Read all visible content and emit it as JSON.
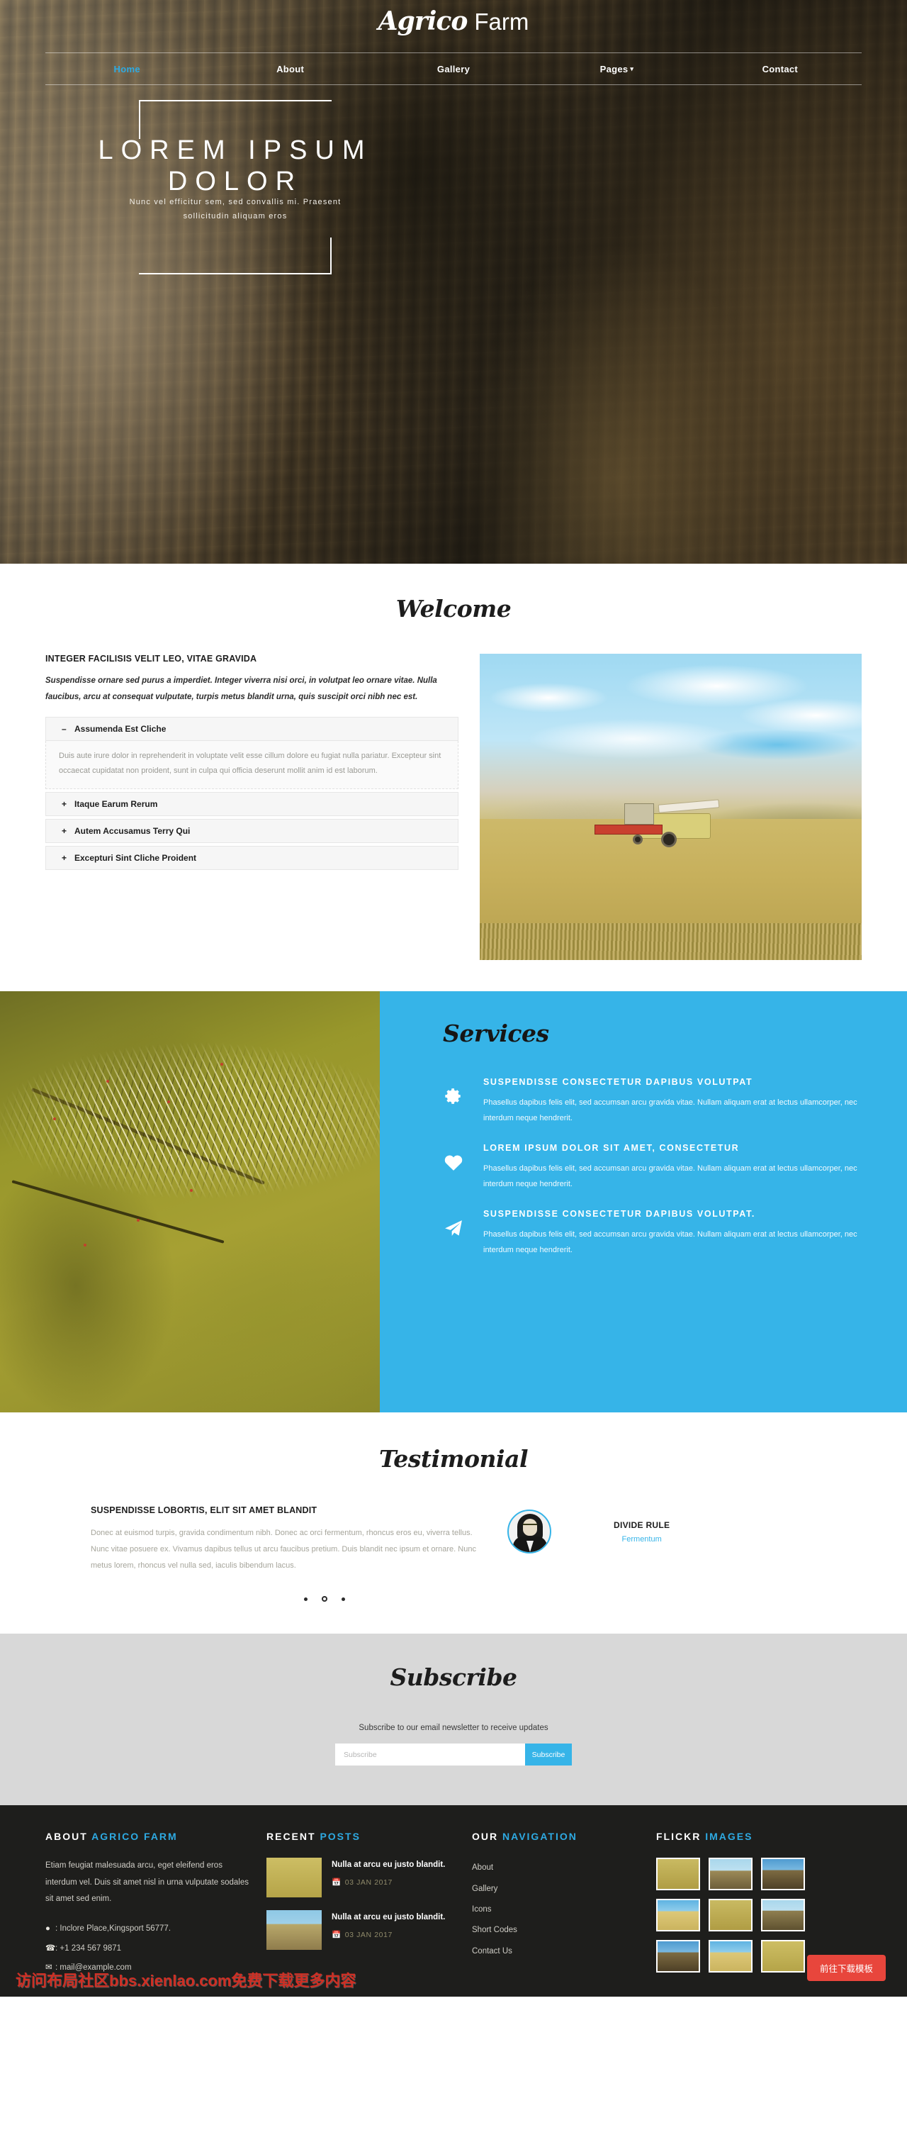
{
  "brand": {
    "word1": "Agrico",
    "word2": "Farm"
  },
  "nav": {
    "items": [
      {
        "label": "Home",
        "active": true
      },
      {
        "label": "About",
        "active": false
      },
      {
        "label": "Gallery",
        "active": false
      },
      {
        "label": "Pages",
        "active": false,
        "caret": "▾"
      },
      {
        "label": "Contact",
        "active": false
      }
    ]
  },
  "hero": {
    "title_line1": "LOREM  IPSUM",
    "title_line2": "DOLOR",
    "subtitle_line1": "Nunc vel efficitur sem, sed convallis mi. Praesent",
    "subtitle_line2": "sollicitudin aliquam eros"
  },
  "welcome": {
    "title": "Welcome",
    "heading": "INTEGER FACILISIS VELIT LEO, VITAE GRAVIDA",
    "lead": "Suspendisse ornare sed purus a imperdiet. Integer viverra nisi orci, in volutpat leo ornare vitae. Nulla faucibus, arcu at consequat vulputate, turpis metus blandit urna, quis suscipit orci nibh nec est.",
    "accordion": [
      {
        "sign": "–",
        "label": "Assumenda Est Cliche",
        "open": true,
        "body": "Duis aute irure dolor in reprehenderit in voluptate velit esse cillum dolore eu fugiat nulla pariatur. Excepteur sint occaecat cupidatat non proident, sunt in culpa qui officia deserunt mollit anim id est laborum."
      },
      {
        "sign": "+",
        "label": "Itaque Earum Rerum",
        "open": false,
        "body": ""
      },
      {
        "sign": "+",
        "label": "Autem Accusamus Terry Qui",
        "open": false,
        "body": ""
      },
      {
        "sign": "+",
        "label": "Excepturi Sint Cliche Proident",
        "open": false,
        "body": ""
      }
    ]
  },
  "services": {
    "title": "Services",
    "bg_color": "#36b4e8",
    "items": [
      {
        "icon": "gear-icon",
        "heading": "SUSPENDISSE CONSECTETUR DAPIBUS VOLUTPAT",
        "text": "Phasellus dapibus felis elit, sed accumsan arcu gravida vitae. Nullam aliquam erat at lectus ullamcorper, nec interdum neque hendrerit."
      },
      {
        "icon": "heart-icon",
        "heading": "LOREM IPSUM DOLOR SIT AMET, CONSECTETUR",
        "text": "Phasellus dapibus felis elit, sed accumsan arcu gravida vitae. Nullam aliquam erat at lectus ullamcorper, nec interdum neque hendrerit."
      },
      {
        "icon": "paper-plane-icon",
        "heading": "SUSPENDISSE CONSECTETUR DAPIBUS VOLUTPAT.",
        "text": "Phasellus dapibus felis elit, sed accumsan arcu gravida vitae. Nullam aliquam erat at lectus ullamcorper, nec interdum neque hendrerit."
      }
    ]
  },
  "testimonial": {
    "title": "Testimonial",
    "heading": "SUSPENDISSE LOBORTIS, ELIT SIT AMET BLANDIT",
    "text": "Donec at euismod turpis, gravida condimentum nibh. Donec ac orci fermentum, rhoncus eros eu, viverra tellus. Nunc vitae posuere ex. Vivamus dapibus tellus ut arcu faucibus pretium. Duis blandit nec ipsum et ornare. Nunc metus lorem, rhoncus vel nulla sed, iaculis bibendum lacus.",
    "author_name": "DIVIDE RULE",
    "author_role": "Fermentum",
    "dots": [
      "dot",
      "ring",
      "dot"
    ]
  },
  "subscribe": {
    "title": "Subscribe",
    "note": "Subscribe to our email newsletter to receive updates",
    "placeholder": "Subscribe",
    "button": "Subscribe"
  },
  "footer": {
    "about": {
      "head_plain": "ABOUT",
      "head_hl": "AGRICO FARM",
      "text": "Etiam feugiat malesuada arcu, eget eleifend eros interdum vel. Duis sit amet nisl in urna vulputate sodales sit amet sed enim.",
      "address": ": Inclore Place,Kingsport 56777.",
      "phone": ": +1 234 567 9871",
      "email": ": mail@example.com"
    },
    "posts": {
      "head_plain": "RECENT",
      "head_hl": "POSTS",
      "items": [
        {
          "title": "Nulla at arcu eu justo blandit.",
          "date": "03 JAN 2017"
        },
        {
          "title": "Nulla at arcu eu justo blandit.",
          "date": "03 JAN 2017"
        }
      ]
    },
    "navigation": {
      "head_plain": "OUR",
      "head_hl": "NAVIGATION",
      "items": [
        "About",
        "Gallery",
        "Icons",
        "Short Codes",
        "Contact Us"
      ]
    },
    "flickr": {
      "head_plain": "FLICKR",
      "head_hl": "IMAGES"
    }
  },
  "overlay": {
    "watermark": "访问布局社区bbs.xienlao.com免费下载更多内容",
    "download_button": "前往下载模板"
  }
}
